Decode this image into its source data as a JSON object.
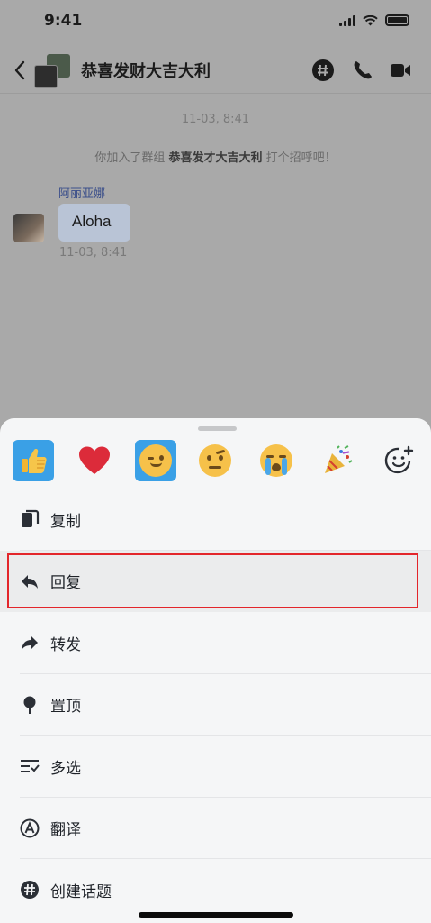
{
  "status_bar": {
    "time": "9:41"
  },
  "header": {
    "title": "恭喜发财大吉大利"
  },
  "chat": {
    "timestamp": "11-03, 8:41",
    "system_prefix": "你加入了群组 ",
    "system_group": "恭喜发才大吉大利",
    "system_suffix": " 打个招呼吧！",
    "message": {
      "sender": "阿丽亚娜",
      "text": "Aloha",
      "time": "11-03, 8:41"
    }
  },
  "reactions": [
    "thumbs-up",
    "heart",
    "wink",
    "raised-eyebrow",
    "crying",
    "party-popper",
    "add-reaction"
  ],
  "menu": [
    {
      "label": "复制",
      "icon": "copy-icon"
    },
    {
      "label": "回复",
      "icon": "reply-icon"
    },
    {
      "label": "转发",
      "icon": "forward-icon"
    },
    {
      "label": "置顶",
      "icon": "pin-icon"
    },
    {
      "label": "多选",
      "icon": "multiselect-icon"
    },
    {
      "label": "翻译",
      "icon": "translate-icon"
    },
    {
      "label": "创建话题",
      "icon": "topic-icon"
    }
  ],
  "colors": {
    "highlight_border": "#e3262b",
    "accent_blue": "#3aa0e6"
  }
}
